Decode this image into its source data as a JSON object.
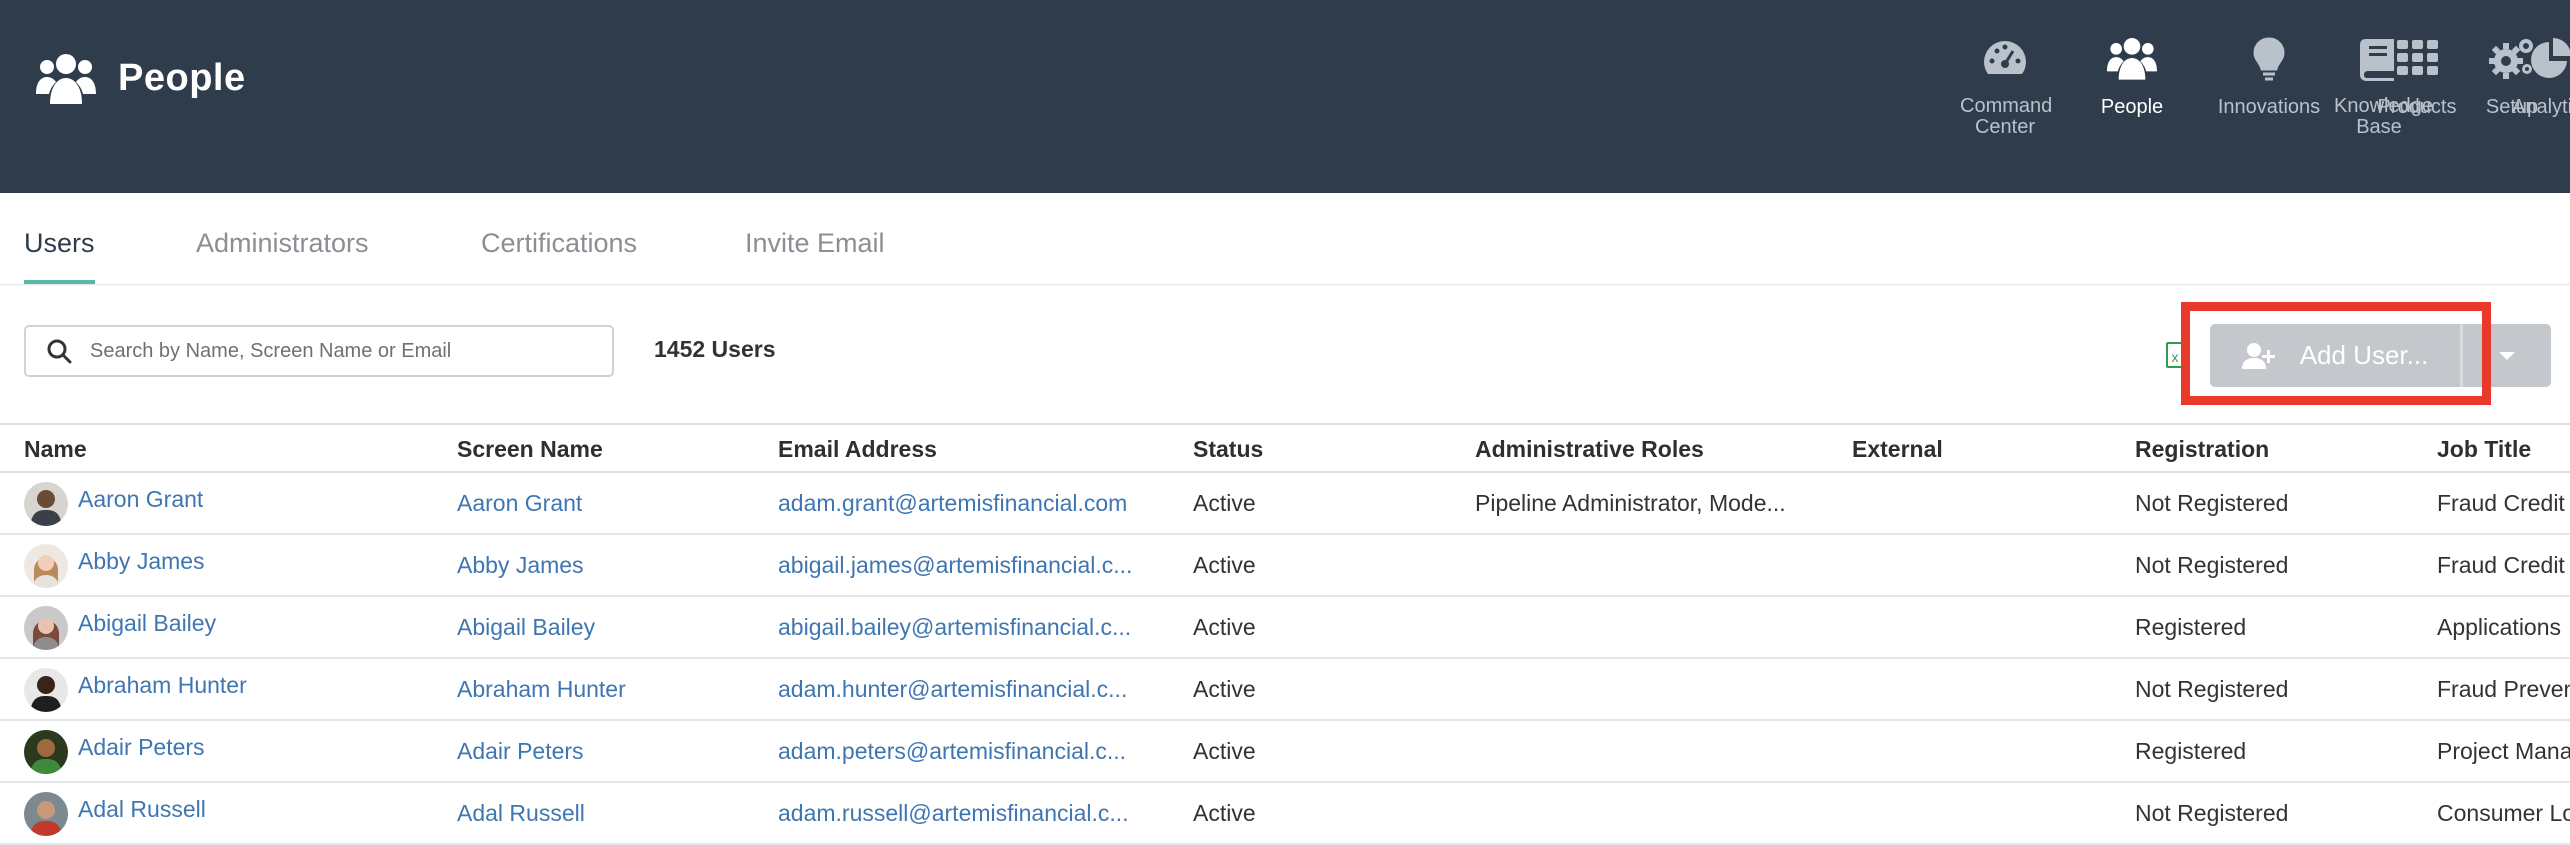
{
  "app": {
    "title": "People",
    "nav": [
      {
        "label": "Command Center",
        "icon": "dashboard-gauge-icon",
        "active": false
      },
      {
        "label": "People",
        "icon": "people-group-icon",
        "active": true
      },
      {
        "label": "Innovations",
        "icon": "lightbulb-icon",
        "active": false
      },
      {
        "label": "Products",
        "icon": "grid-apps-icon",
        "active": false
      },
      {
        "label": "Analytics",
        "icon": "pie-chart-icon",
        "active": false
      },
      {
        "label": "Knowledge Base",
        "icon": "book-icon",
        "active": false
      },
      {
        "label": "Setup",
        "icon": "gears-icon",
        "active": false
      }
    ]
  },
  "tabs": [
    {
      "label": "Users",
      "active": true
    },
    {
      "label": "Administrators",
      "active": false
    },
    {
      "label": "Certifications",
      "active": false
    },
    {
      "label": "Invite Email",
      "active": false
    }
  ],
  "toolbar": {
    "search_placeholder": "Search by Name, Screen Name or Email",
    "search_value": "",
    "user_count": "1452 Users",
    "add_user_label": "Add User...",
    "export_icon": "excel-export-icon"
  },
  "table": {
    "columns": [
      "Name",
      "Screen Name",
      "Email Address",
      "Status",
      "Administrative Roles",
      "External",
      "Registration",
      "Job Title"
    ],
    "rows": [
      {
        "name": "Aaron Grant",
        "screen_name": "Aaron Grant",
        "email": "adam.grant@artemisfinancial.com",
        "status": "Active",
        "roles": "Pipeline Administrator, Mode...",
        "external": "",
        "registration": "Not Registered",
        "job_title": "Fraud Credit"
      },
      {
        "name": "Abby James",
        "screen_name": "Abby James",
        "email": "abigail.james@artemisfinancial.c...",
        "status": "Active",
        "roles": "",
        "external": "",
        "registration": "Not Registered",
        "job_title": "Fraud Credit"
      },
      {
        "name": "Abigail Bailey",
        "screen_name": "Abigail Bailey",
        "email": "abigail.bailey@artemisfinancial.c...",
        "status": "Active",
        "roles": "",
        "external": "",
        "registration": "Registered",
        "job_title": "Applications"
      },
      {
        "name": "Abraham Hunter",
        "screen_name": "Abraham Hunter",
        "email": "adam.hunter@artemisfinancial.c...",
        "status": "Active",
        "roles": "",
        "external": "",
        "registration": "Not Registered",
        "job_title": "Fraud Preven"
      },
      {
        "name": "Adair Peters",
        "screen_name": "Adair Peters",
        "email": "adam.peters@artemisfinancial.c...",
        "status": "Active",
        "roles": "",
        "external": "",
        "registration": "Registered",
        "job_title": "Project Mana"
      },
      {
        "name": "Adal Russell",
        "screen_name": "Adal Russell",
        "email": "adam.russell@artemisfinancial.c...",
        "status": "Active",
        "roles": "",
        "external": "",
        "registration": "Not Registered",
        "job_title": "Consumer Lo"
      }
    ]
  },
  "colors": {
    "header_bg": "#2f3c4c",
    "link": "#3f76b2",
    "tab_accent": "#59b9a6",
    "highlight": "#e9392a",
    "button_disabled": "#c4c7cb"
  }
}
